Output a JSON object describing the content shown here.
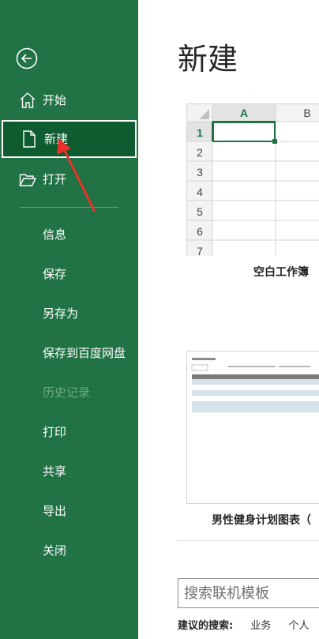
{
  "sidebar": {
    "items": [
      {
        "label": "开始",
        "icon": "home-icon"
      },
      {
        "label": "新建",
        "icon": "new-document-icon"
      },
      {
        "label": "打开",
        "icon": "folder-open-icon"
      },
      {
        "label": "信息"
      },
      {
        "label": "保存"
      },
      {
        "label": "另存为"
      },
      {
        "label": "保存到百度网盘"
      },
      {
        "label": "历史记录"
      },
      {
        "label": "打印"
      },
      {
        "label": "共享"
      },
      {
        "label": "导出"
      },
      {
        "label": "关闭"
      }
    ],
    "active": "新建",
    "disabled": "历史记录"
  },
  "main": {
    "title": "新建",
    "templates": [
      {
        "name": "空白工作簿"
      },
      {
        "name": "男性健身计划图表（"
      }
    ],
    "blank_preview": {
      "columns": [
        "A",
        "B"
      ],
      "rows": [
        "1",
        "2",
        "3",
        "4",
        "5",
        "6",
        "7"
      ]
    },
    "search": {
      "placeholder": "搜索联机模板"
    },
    "suggested": {
      "label": "建议的搜索:",
      "links": [
        "业务",
        "个人"
      ]
    }
  },
  "colors": {
    "sidebar_bg": "#217346",
    "active_bg": "#0e5c2f",
    "annotation_arrow": "#e8312a",
    "excel_green": "#217346"
  }
}
